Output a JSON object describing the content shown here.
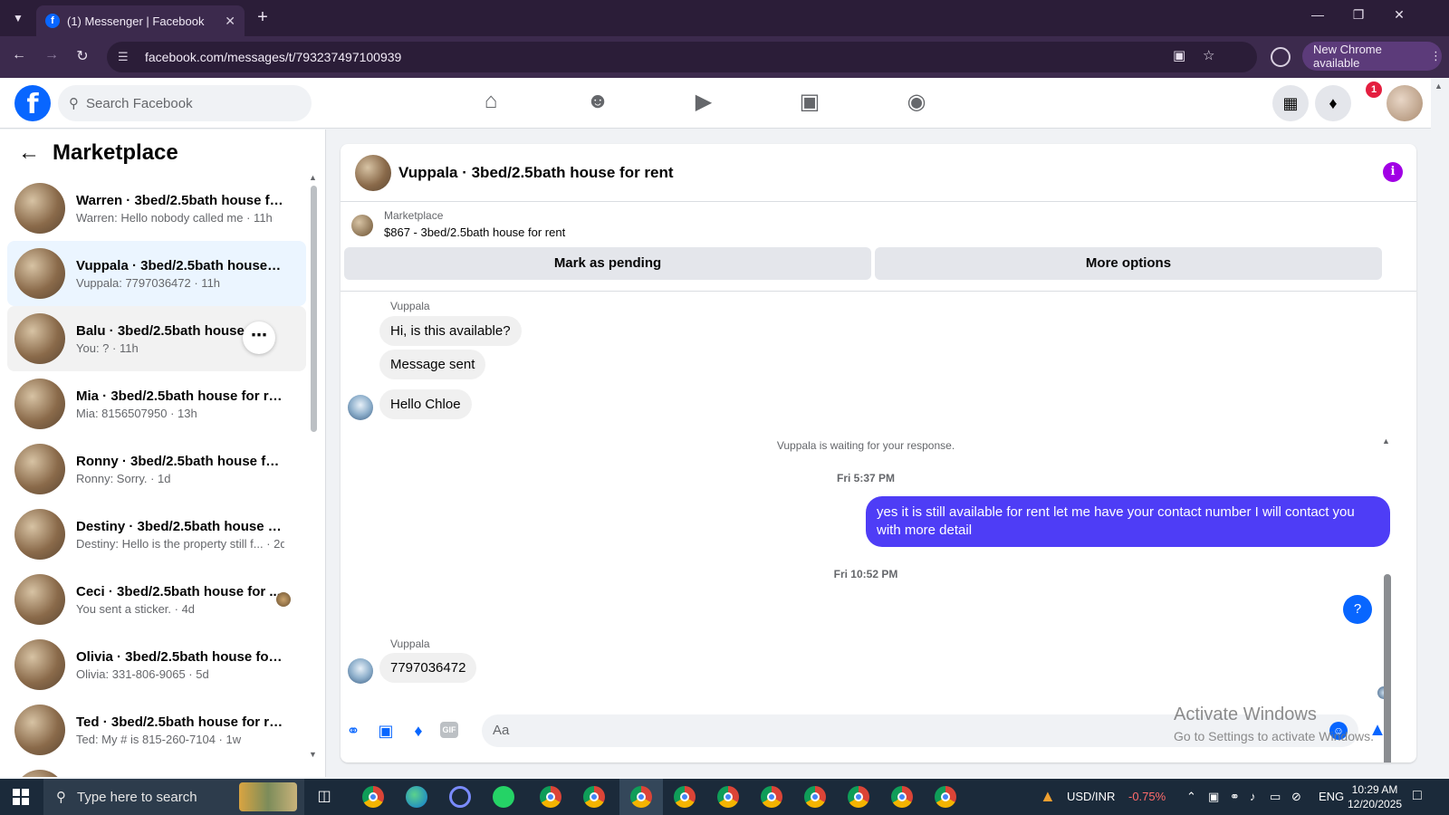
{
  "browser": {
    "tab_title": "(1) Messenger | Facebook",
    "url": "facebook.com/messages/t/793237497100939",
    "new_chrome_label": "New Chrome available"
  },
  "fb": {
    "search_placeholder": "Search Facebook",
    "notification_count": "1",
    "brand_color": "#0866ff"
  },
  "sidebar": {
    "title": "Marketplace",
    "conversations": [
      {
        "name": "Warren · 3bed/2.5bath house fo...",
        "sub": "Warren: Hello nobody called me · 11h"
      },
      {
        "name": "Vuppala · 3bed/2.5bath house f...",
        "sub": "Vuppala: 7797036472 · 11h"
      },
      {
        "name": "Balu · 3bed/2.5bath house fo...",
        "sub": "You: ? · 11h"
      },
      {
        "name": "Mia · 3bed/2.5bath house for rent",
        "sub": "Mia: 8156507950 · 13h"
      },
      {
        "name": "Ronny · 3bed/2.5bath house for ...",
        "sub": "Ronny: Sorry. · 1d"
      },
      {
        "name": "Destiny · 3bed/2.5bath house fo...",
        "sub": "Destiny: Hello is the property still f... · 2d"
      },
      {
        "name": "Ceci · 3bed/2.5bath house for ...",
        "sub": "You sent a sticker. · 4d"
      },
      {
        "name": "Olivia · 3bed/2.5bath house for r...",
        "sub": "Olivia: 331-806-9065 · 5d"
      },
      {
        "name": "Ted · 3bed/2.5bath house for rent",
        "sub": "Ted: My # is 815-260-7104 · 1w"
      }
    ]
  },
  "chat": {
    "title": "Vuppala · 3bed/2.5bath house for rent",
    "listing_label": "Marketplace",
    "listing_detail": "$867 - 3bed/2.5bath house for rent",
    "mark_pending_label": "Mark as pending",
    "more_options_label": "More options",
    "sender_name": "Vuppala",
    "msg1": "Hi, is this available?",
    "msg2": "Message sent",
    "msg3": "Hello Chloe",
    "waiting_note": "Vuppala is waiting for your response.",
    "time1": "Fri 5:37 PM",
    "out_msg": "yes it is still available for rent let me have your contact number I will contact you with more detail",
    "time2": "Fri 10:52 PM",
    "out_q": "?",
    "sender_name2": "Vuppala",
    "msg4": "7797036472",
    "composer_placeholder": "Aa",
    "gif_label": "GIF",
    "out_bubble_color": "#4e3df6"
  },
  "watermark": {
    "line1": "Activate Windows",
    "line2": "Go to Settings to activate Windows."
  },
  "taskbar": {
    "search_placeholder": "Type here to search",
    "ticker": "USD/INR",
    "ticker_change": "-0.75%",
    "lang": "ENG",
    "time": "10:29 AM",
    "date": "12/20/2025"
  }
}
